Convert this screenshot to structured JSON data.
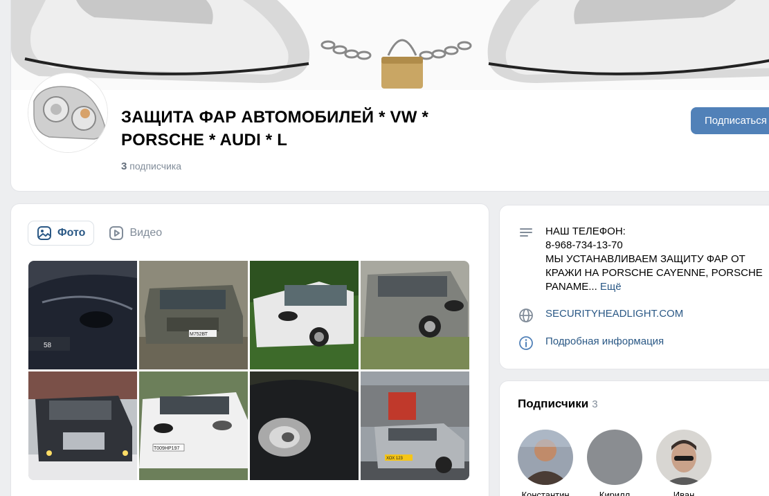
{
  "group": {
    "title": "ЗАЩИТА ФАР АВТОМОБИЛЕЙ * VW * PORSCHE * AUDI * L",
    "members_count": "3",
    "members_label": "подписчика",
    "subscribe_label": "Подписаться"
  },
  "media": {
    "tabs": [
      {
        "label": "Фото",
        "active": true,
        "icon": "photo-icon"
      },
      {
        "label": "Видео",
        "active": false,
        "icon": "video-icon"
      }
    ],
    "photos": [
      {
        "icon": "car-photo",
        "plate": "58"
      },
      {
        "icon": "car-photo",
        "plate": "М752ВТ"
      },
      {
        "icon": "car-photo",
        "plate": ""
      },
      {
        "icon": "car-photo",
        "plate": ""
      },
      {
        "icon": "car-photo",
        "plate": ""
      },
      {
        "icon": "car-photo",
        "plate": "Т009НР197"
      },
      {
        "icon": "car-photo",
        "plate": ""
      },
      {
        "icon": "car-photo",
        "plate": "ХОХ 123"
      }
    ]
  },
  "info": {
    "description_lines": [
      "НАШ ТЕЛЕФОН:",
      "8-968-734-13-70",
      "МЫ УСТАНАВЛИВАЕМ ЗАЩИТУ ФАР ОТ",
      "КРАЖИ НА PORSCHE CAYENNE, PORSCHE",
      "PANAME..."
    ],
    "more_label": "Ещё",
    "website": "SECURITYHEADLIGHT.COM",
    "details_label": "Подробная информация"
  },
  "subscribers": {
    "title": "Подписчики",
    "count": "3",
    "names": [
      "Константин",
      "Кирилл",
      "Иван"
    ]
  },
  "colors": {
    "accent": "#5181b8",
    "link": "#2a5885",
    "secondary_text": "#818c99",
    "background": "#edeef0"
  }
}
